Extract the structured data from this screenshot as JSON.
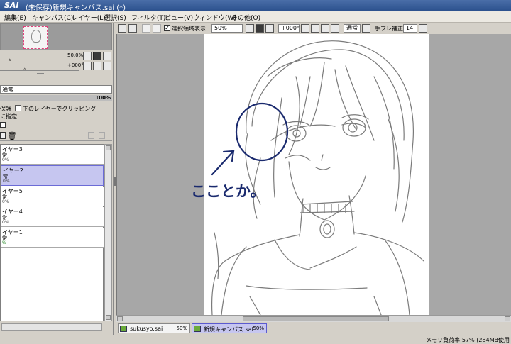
{
  "window": {
    "logo": "SAI",
    "title": "(未保存)新規キャンバス.sai (*)"
  },
  "menu": [
    "編集(E)",
    "キャンバス(C)",
    "レイヤー(L)",
    "選択(S)",
    "フィルタ(T)",
    "ビュー(V)",
    "ウィンドウ(W)",
    "その他(O)"
  ],
  "navigator": {
    "zoom": "50.0%",
    "rotation": "+000°"
  },
  "layer_props": {
    "blend_mode": "通常",
    "opacity": "100%",
    "protect_label": "保護",
    "clipping_label": "下のレイヤーでクリッピング",
    "selection_source_label": "に指定"
  },
  "layers": [
    {
      "name": "イヤー3",
      "mode": "常",
      "opacity": "0%"
    },
    {
      "name": "イヤー2",
      "mode": "常",
      "opacity": "0%"
    },
    {
      "name": "イヤー5",
      "mode": "常",
      "opacity": "0%"
    },
    {
      "name": "イヤー4",
      "mode": "常",
      "opacity": "0%"
    },
    {
      "name": "イヤー1",
      "mode": "常",
      "opacity": "%"
    }
  ],
  "toolbar": {
    "show_selection_label": "選択領域表示",
    "zoom": "50%",
    "rotation": "+000°",
    "blend": "通常",
    "stabilizer_label": "手ブレ補正",
    "stabilizer_value": "14"
  },
  "canvas": {
    "annotation": "こことか。"
  },
  "tabs": [
    {
      "name": "sukusyo.sai",
      "zoom": "50%"
    },
    {
      "name": "新規キャンバス.sai",
      "zoom": "50%"
    }
  ],
  "status": {
    "memory": "メモリ負荷率:57% (284MB使用"
  },
  "colors": {
    "title_bar": "#2a4f8c",
    "selected_layer": "#c6c6f0",
    "annotation_ink": "#1a2a6e",
    "sketch_line": "#7a7a7a"
  }
}
